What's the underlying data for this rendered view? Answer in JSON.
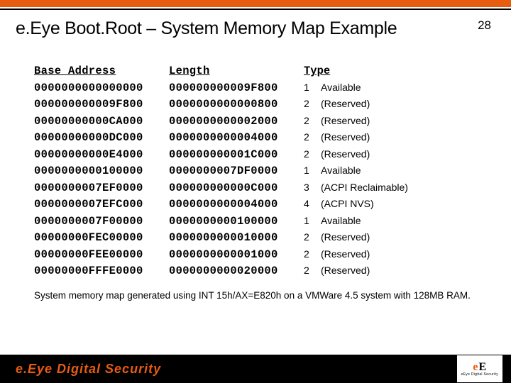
{
  "page_number": "28",
  "title": "e.Eye Boot.Root – System Memory Map Example",
  "headers": {
    "base": "Base Address",
    "length": "Length",
    "type": "Type"
  },
  "rows": [
    {
      "base": "0000000000000000",
      "len": "000000000009F800",
      "code": "1",
      "name": "Available"
    },
    {
      "base": "000000000009F800",
      "len": "0000000000000800",
      "code": "2",
      "name": "(Reserved)"
    },
    {
      "base": "00000000000CA000",
      "len": "0000000000002000",
      "code": "2",
      "name": "(Reserved)"
    },
    {
      "base": "00000000000DC000",
      "len": "0000000000004000",
      "code": "2",
      "name": "(Reserved)"
    },
    {
      "base": "00000000000E4000",
      "len": "000000000001C000",
      "code": "2",
      "name": "(Reserved)"
    },
    {
      "base": "0000000000100000",
      "len": "0000000007DF0000",
      "code": "1",
      "name": "Available"
    },
    {
      "base": "0000000007EF0000",
      "len": "000000000000C000",
      "code": "3",
      "name": "(ACPI Reclaimable)"
    },
    {
      "base": "0000000007EFC000",
      "len": "0000000000004000",
      "code": "4",
      "name": "(ACPI NVS)"
    },
    {
      "base": "0000000007F00000",
      "len": "0000000000100000",
      "code": "1",
      "name": "Available"
    },
    {
      "base": "00000000FEC00000",
      "len": "0000000000010000",
      "code": "2",
      "name": "(Reserved)"
    },
    {
      "base": "00000000FEE00000",
      "len": "0000000000001000",
      "code": "2",
      "name": "(Reserved)"
    },
    {
      "base": "00000000FFFE0000",
      "len": "0000000000020000",
      "code": "2",
      "name": "(Reserved)"
    }
  ],
  "footnote": "System memory map generated using INT 15h/AX=E820h on a VMWare 4.5 system with 128MB RAM.",
  "footer_brand": "e.Eye Digital Security",
  "logo": {
    "part1": "e",
    "part2": "E",
    "sub": "eEye Digital Security"
  }
}
